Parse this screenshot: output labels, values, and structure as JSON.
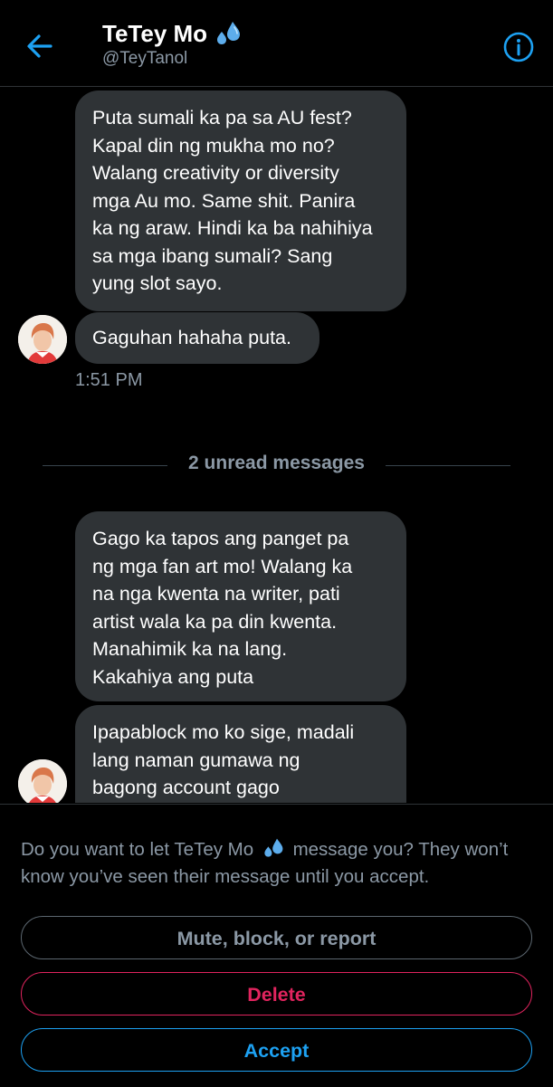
{
  "header": {
    "title": "TeTey Mo",
    "handle": "@TeyTanol"
  },
  "icons": {
    "back": "arrow-left-icon",
    "info": "info-icon",
    "title_emoji": "sweat-droplets-emoji"
  },
  "colors": {
    "accent": "#1da1f2",
    "danger": "#e0245e",
    "bubble": "#2f3336",
    "muted_text": "#8b98a5"
  },
  "messages": {
    "group1": {
      "bubble1": [
        "Puta sumali ka pa sa AU fest?",
        "Kapal din ng mukha mo no?",
        "Walang creativity or diversity",
        "mga Au mo. Same shit. Panira",
        "ka ng araw. Hindi ka ba nahihiya",
        "sa mga ibang sumali? Sang",
        "yung slot sayo."
      ],
      "bubble2": "Gaguhan hahaha puta.",
      "time": "1:51 PM"
    },
    "unread_label": "2 unread messages",
    "group2": {
      "bubble1": [
        "Gago ka tapos ang panget pa",
        "ng mga fan art mo! Walang ka",
        "na nga kwenta na writer, pati",
        "artist wala ka pa din kwenta.",
        "Manahimik ka na lang.",
        "Kakahiya ang puta"
      ],
      "bubble2": [
        "Ipapablock mo ko sige, madali",
        "lang naman gumawa ng",
        "bagong account gago"
      ]
    }
  },
  "prompt": {
    "text_before": "Do you want to let TeTey Mo",
    "text_after": "message you? They won’t know you’ve seen their message until you accept.",
    "mute_label": "Mute, block, or report",
    "delete_label": "Delete",
    "accept_label": "Accept"
  }
}
